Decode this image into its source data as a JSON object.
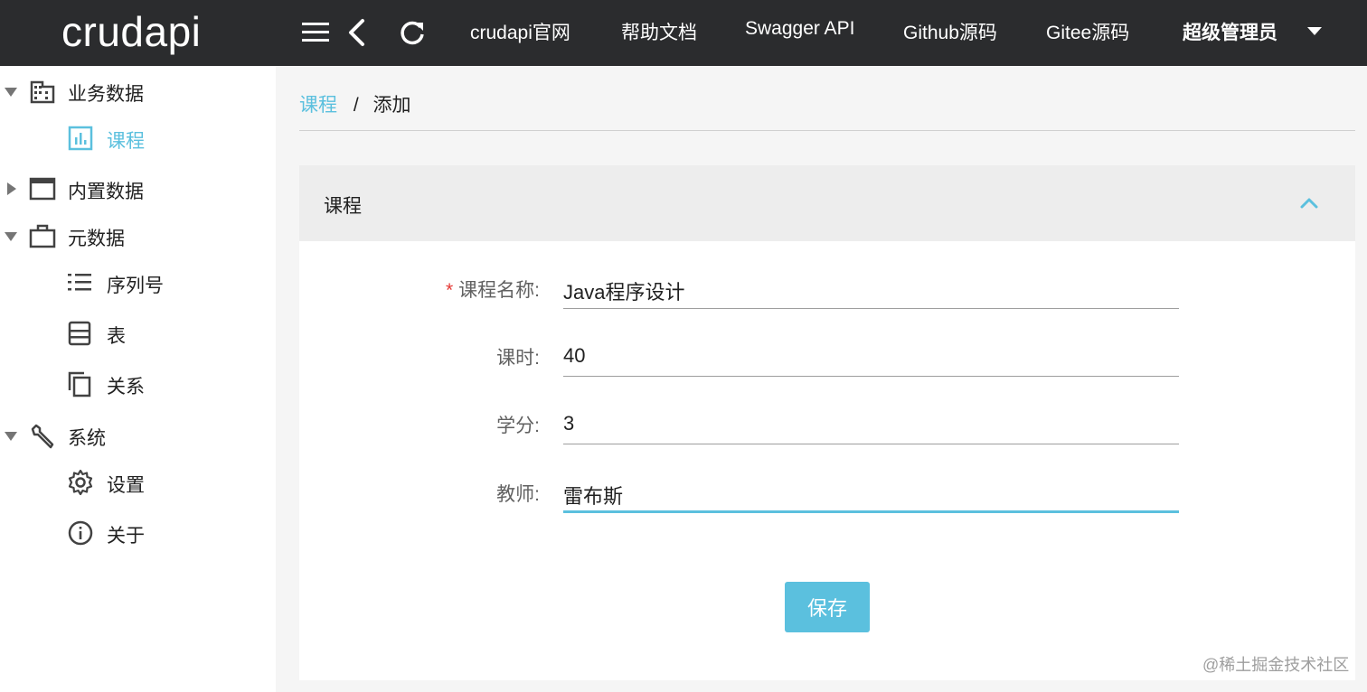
{
  "header": {
    "logo": "crudapi",
    "nav": [
      "crudapi官网",
      "帮助文档",
      "Swagger API",
      "Github源码",
      "Gitee源码"
    ],
    "user": "超级管理员"
  },
  "sidebar": {
    "groups": [
      {
        "label": "业务数据",
        "icon": "building-icon",
        "expanded": true,
        "items": [
          {
            "label": "课程",
            "icon": "chart-icon",
            "active": true
          }
        ]
      },
      {
        "label": "内置数据",
        "icon": "window-icon",
        "expanded": false,
        "items": []
      },
      {
        "label": "元数据",
        "icon": "briefcase-icon",
        "expanded": true,
        "items": [
          {
            "label": "序列号",
            "icon": "list-icon"
          },
          {
            "label": "表",
            "icon": "table-icon"
          },
          {
            "label": "关系",
            "icon": "copy-icon"
          }
        ]
      },
      {
        "label": "系统",
        "icon": "wrench-icon",
        "expanded": true,
        "items": [
          {
            "label": "设置",
            "icon": "gear-icon"
          },
          {
            "label": "关于",
            "icon": "info-icon"
          }
        ]
      }
    ]
  },
  "breadcrumb": {
    "link": "课程",
    "separator": "/",
    "current": "添加"
  },
  "panel": {
    "title": "课程"
  },
  "form": {
    "fields": [
      {
        "label": "课程名称:",
        "required": true,
        "value": "Java程序设计"
      },
      {
        "label": "课时:",
        "required": false,
        "value": "40"
      },
      {
        "label": "学分:",
        "required": false,
        "value": "3"
      },
      {
        "label": "教师:",
        "required": false,
        "value": "雷布斯",
        "focused": true
      }
    ],
    "save_label": "保存"
  },
  "watermark": "@稀土掘金技术社区",
  "colors": {
    "accent": "#5bc0de",
    "header_bg": "#2b2c2e",
    "required": "#e53935"
  }
}
